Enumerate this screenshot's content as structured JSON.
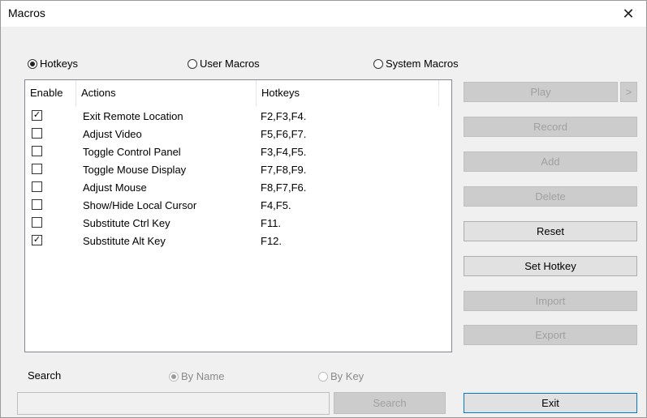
{
  "window": {
    "title": "Macros",
    "close_glyph": "✕"
  },
  "mode_radios": [
    {
      "label": "Hotkeys",
      "checked": true
    },
    {
      "label": "User Macros",
      "checked": false
    },
    {
      "label": "System Macros",
      "checked": false
    }
  ],
  "table": {
    "columns": {
      "enable": "Enable",
      "actions": "Actions",
      "hotkeys": "Hotkeys"
    },
    "rows": [
      {
        "enabled": true,
        "action": "Exit Remote Location",
        "hotkeys": "F2,F3,F4."
      },
      {
        "enabled": false,
        "action": "Adjust Video",
        "hotkeys": "F5,F6,F7."
      },
      {
        "enabled": false,
        "action": "Toggle Control Panel",
        "hotkeys": "F3,F4,F5."
      },
      {
        "enabled": false,
        "action": "Toggle Mouse Display",
        "hotkeys": "F7,F8,F9."
      },
      {
        "enabled": false,
        "action": "Adjust Mouse",
        "hotkeys": "F8,F7,F6."
      },
      {
        "enabled": false,
        "action": "Show/Hide Local Cursor",
        "hotkeys": "F4,F5."
      },
      {
        "enabled": false,
        "action": "Substitute Ctrl Key",
        "hotkeys": "F11."
      },
      {
        "enabled": true,
        "action": "Substitute Alt Key",
        "hotkeys": "F12."
      }
    ],
    "check_glyph": "✓"
  },
  "buttons": {
    "play": "Play",
    "play_more": ">",
    "record": "Record",
    "add": "Add",
    "delete": "Delete",
    "reset": "Reset",
    "set_hotkey": "Set Hotkey",
    "import": "Import",
    "export": "Export",
    "exit": "Exit"
  },
  "search": {
    "label": "Search",
    "by_name": "By Name",
    "by_key": "By Key",
    "input_value": "",
    "button": "Search"
  },
  "colors": {
    "accent_border": "#0078d7",
    "disabled_text": "#a0a0a0"
  }
}
